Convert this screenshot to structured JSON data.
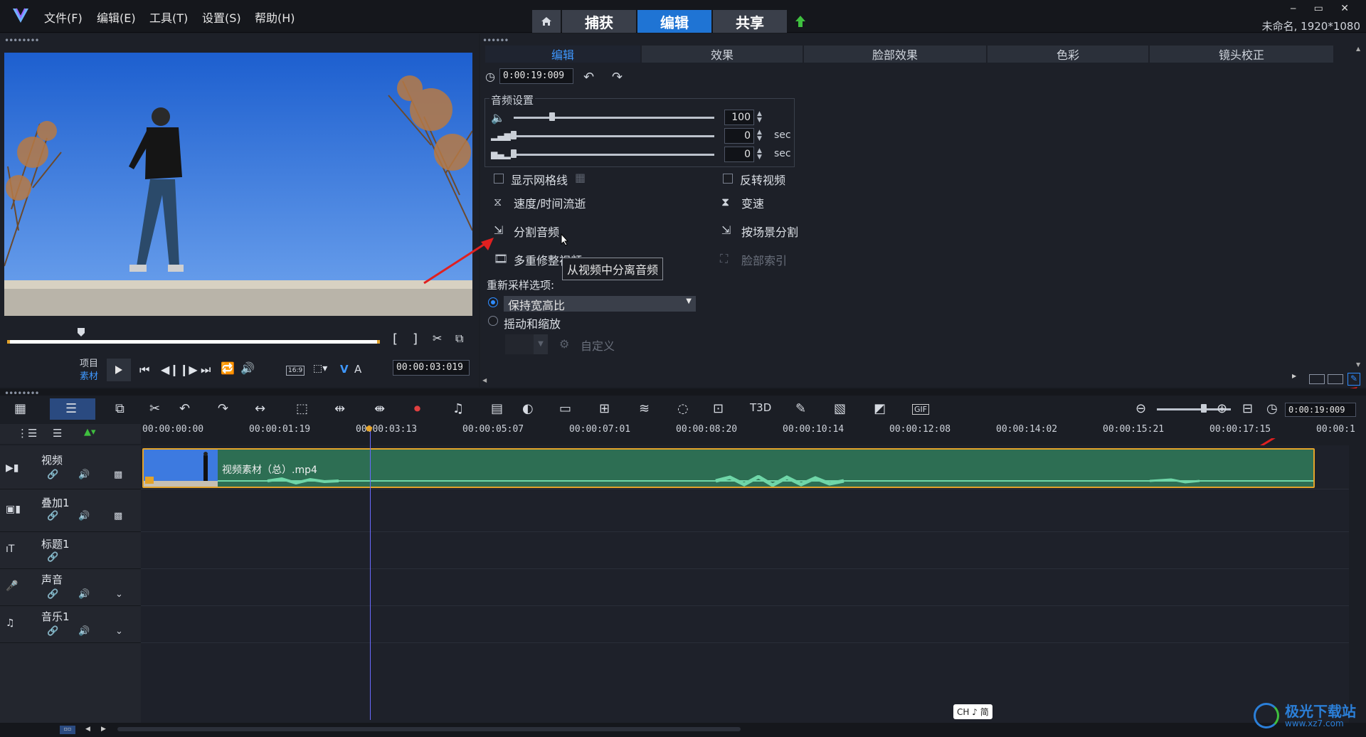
{
  "menu": [
    "文件(F)",
    "编辑(E)",
    "工具(T)",
    "设置(S)",
    "帮助(H)"
  ],
  "mode_tabs": {
    "capture": "捕获",
    "edit": "编辑",
    "share": "共享"
  },
  "window": {
    "controls": "‒ ▭ ✕",
    "project": "未命名, 1920*1080"
  },
  "preview": {
    "project_label": "项目",
    "clip_label": "素材",
    "aspect": "16:9",
    "timecode": "00:00:03:019"
  },
  "options": {
    "tabs": [
      "编辑",
      "效果",
      "脸部效果",
      "色彩",
      "镜头校正"
    ],
    "duration": "0:00:19:009",
    "audio_group_title": "音频设置",
    "volume": "100",
    "fade_in": "0",
    "fade_out": "0",
    "unit_sec": "sec",
    "show_grid": "显示网格线",
    "reverse_video": "反转视频",
    "speed_time_lapse": "速度/时间流逝",
    "variable_speed": "变速",
    "split_audio": "分割音频",
    "split_by_scene": "按场景分割",
    "multi_trim": "多重修整视频",
    "face_index": "脸部索引",
    "tooltip": "从视频中分离音频",
    "resample_label": "重新采样选项:",
    "resample_value": "保持宽高比",
    "pan_zoom": "摇动和缩放",
    "custom": "自定义"
  },
  "timeline": {
    "zoom_timecode": "0:00:19:009",
    "ruler": [
      "00:00:00:00",
      "00:00:01:19",
      "00:00:03:13",
      "00:00:05:07",
      "00:00:07:01",
      "00:00:08:20",
      "00:00:10:14",
      "00:00:12:08",
      "00:00:14:02",
      "00:00:15:21",
      "00:00:17:15",
      "00:00:1"
    ],
    "tracks": [
      "视频",
      "叠加1",
      "标题1",
      "声音",
      "音乐1"
    ],
    "clip_name": "视频素材（总）.mp4"
  },
  "ime": "CH ♪ 简",
  "watermark": {
    "brand": "极光下载站",
    "url": "www.xz7.com"
  },
  "colors": {
    "accent": "#1f74d4",
    "clip": "#2d6e53",
    "clip_border": "#e3a32a",
    "annotation": "#e02020"
  }
}
